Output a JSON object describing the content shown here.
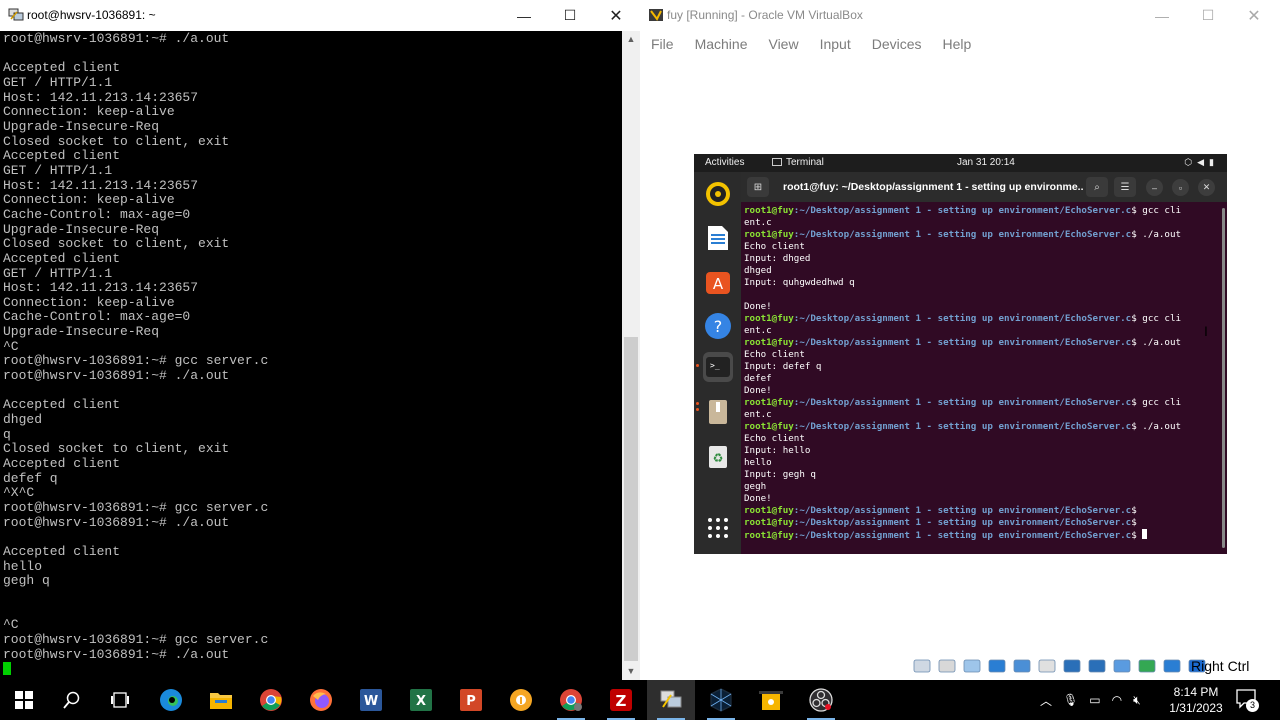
{
  "putty": {
    "title": "root@hwsrv-1036891: ~",
    "lines": [
      "root@hwsrv-1036891:~# ./a.out",
      "",
      "Accepted client",
      "GET / HTTP/1.1",
      "Host: 142.11.213.14:23657",
      "Connection: keep-alive",
      "Upgrade-Insecure-Req",
      "Closed socket to client, exit",
      "Accepted client",
      "GET / HTTP/1.1",
      "Host: 142.11.213.14:23657",
      "Connection: keep-alive",
      "Cache-Control: max-age=0",
      "Upgrade-Insecure-Req",
      "Closed socket to client, exit",
      "Accepted client",
      "GET / HTTP/1.1",
      "Host: 142.11.213.14:23657",
      "Connection: keep-alive",
      "Cache-Control: max-age=0",
      "Upgrade-Insecure-Req",
      "^C",
      "root@hwsrv-1036891:~# gcc server.c",
      "root@hwsrv-1036891:~# ./a.out",
      "",
      "Accepted client",
      "dhged",
      "q",
      "Closed socket to client, exit",
      "Accepted client",
      "defef q",
      "^X^C",
      "root@hwsrv-1036891:~# gcc server.c",
      "root@hwsrv-1036891:~# ./a.out",
      "",
      "Accepted client",
      "hello",
      "gegh q",
      "",
      "",
      "^C",
      "root@hwsrv-1036891:~# gcc server.c",
      "root@hwsrv-1036891:~# ./a.out"
    ]
  },
  "vbox": {
    "title": "fuy [Running] - Oracle VM VirtualBox",
    "menu": [
      "File",
      "Machine",
      "View",
      "Input",
      "Devices",
      "Help"
    ],
    "host_key": "Right Ctrl",
    "status_icons": [
      "optical-drive-icon",
      "audio-icon",
      "usb-icon",
      "network-icon",
      "shared-folders-icon",
      "display-icon",
      "video-capture-icon",
      "vrde-icon",
      "cpu-icon",
      "mouse-integration-icon",
      "keyboard-icon",
      "arrow-down-icon"
    ]
  },
  "guest": {
    "activities": "Activities",
    "app_name": "Terminal",
    "clock": "Jan 31  20:14",
    "terminal_title": "root1@fuy: ~/Desktop/assignment 1 - setting up environme...",
    "prompt_user": "root1@fuy",
    "prompt_path": ":~/Desktop/assignment 1 - setting up environment/EchoServer.c",
    "lines": [
      {
        "p": true,
        "cmd": "$ gcc cli"
      },
      {
        "p": false,
        "text": "ent.c"
      },
      {
        "p": true,
        "cmd": "$ ./a.out"
      },
      {
        "p": false,
        "text": "Echo client"
      },
      {
        "p": false,
        "text": "Input: dhged"
      },
      {
        "p": false,
        "text": "dhged"
      },
      {
        "p": false,
        "text": "Input: quhgwdedhwd q"
      },
      {
        "p": false,
        "text": ""
      },
      {
        "p": false,
        "text": "Done!"
      },
      {
        "p": true,
        "cmd": "$ gcc cli"
      },
      {
        "p": false,
        "text": "ent.c"
      },
      {
        "p": true,
        "cmd": "$ ./a.out"
      },
      {
        "p": false,
        "text": "Echo client"
      },
      {
        "p": false,
        "text": "Input: defef q"
      },
      {
        "p": false,
        "text": "defef"
      },
      {
        "p": false,
        "text": "Done!"
      },
      {
        "p": true,
        "cmd": "$ gcc cli"
      },
      {
        "p": false,
        "text": "ent.c"
      },
      {
        "p": true,
        "cmd": "$ ./a.out"
      },
      {
        "p": false,
        "text": "Echo client"
      },
      {
        "p": false,
        "text": "Input: hello"
      },
      {
        "p": false,
        "text": "hello"
      },
      {
        "p": false,
        "text": "Input: gegh q"
      },
      {
        "p": false,
        "text": "gegh"
      },
      {
        "p": false,
        "text": "Done!"
      },
      {
        "p": true,
        "cmd": "$"
      },
      {
        "p": true,
        "cmd": "$"
      },
      {
        "p": true,
        "cmd": "$ ",
        "cursor": true
      }
    ],
    "dock": [
      "rhythmbox-icon",
      "libreoffice-writer-icon",
      "software-center-icon",
      "help-icon",
      "terminal-icon",
      "archive-icon",
      "trash-icon",
      "app-grid-icon"
    ]
  },
  "taskbar": {
    "time": "8:14 PM",
    "date": "1/31/2023",
    "notifications": "3",
    "items": [
      "start-icon",
      "search-icon",
      "task-view-icon",
      "edge-icon",
      "file-explorer-icon",
      "chrome-icon",
      "firefox-icon",
      "word-icon",
      "excel-icon",
      "powerpoint-icon",
      "brave-icon",
      "chrome-profile-icon",
      "filezilla-icon",
      "putty-icon",
      "virtualbox-icon",
      "sublime-icon",
      "obs-icon"
    ]
  },
  "colors": {
    "terminal_bg": "#300a24",
    "prompt_user": "#8ae234",
    "prompt_path": "#729fcf",
    "putty_text": "#c0c0c0",
    "putty_cursor": "#00d000"
  }
}
